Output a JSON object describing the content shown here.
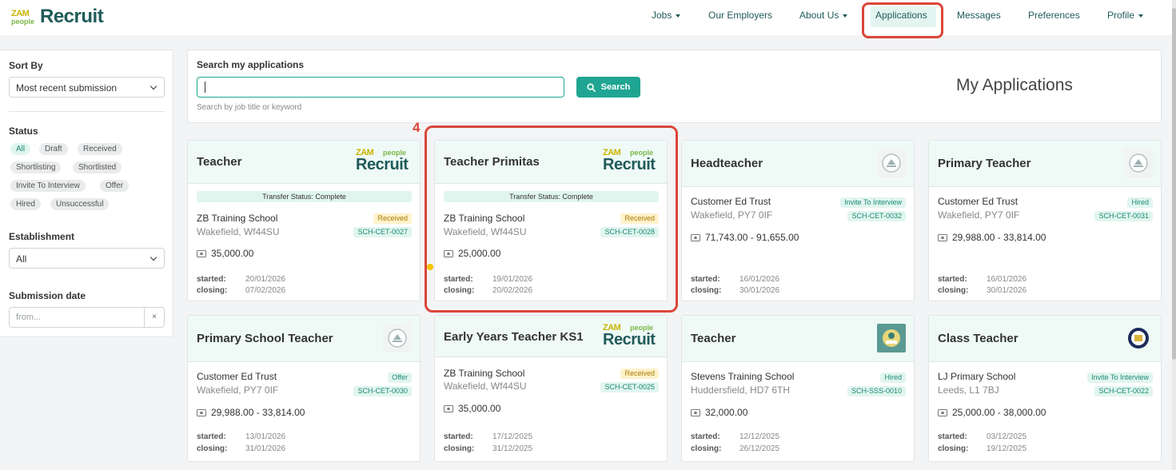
{
  "brand": {
    "logo_top": "ZAM",
    "logo_bottom": "people",
    "logo_word": "Recruit",
    "accent": "#20a592",
    "dark": "#1f5b59"
  },
  "nav": {
    "jobs": "Jobs",
    "employers": "Our Employers",
    "about": "About Us",
    "applications": "Applications",
    "messages": "Messages",
    "preferences": "Preferences",
    "profile": "Profile"
  },
  "sidebar": {
    "sort_label": "Sort By",
    "sort_value": "Most recent submission",
    "status_label": "Status",
    "statuses": [
      "All",
      "Draft",
      "Received",
      "Shortlisting",
      "Shortlisted",
      "Invite To Interview",
      "Offer",
      "Hired",
      "Unsuccessful"
    ],
    "establishment_label": "Establishment",
    "establishment_value": "All",
    "submission_label": "Submission date",
    "from_placeholder": "from...",
    "clear_symbol": "×"
  },
  "search": {
    "label": "Search my applications",
    "button": "Search",
    "help": "Search by job title or keyword",
    "value": ""
  },
  "page_title": "My Applications",
  "annotation": {
    "step": "4"
  },
  "cards": [
    {
      "title": "Teacher",
      "logo": "recruit",
      "transfer": "Transfer Status: Complete",
      "org": "ZB Training School",
      "location": "Wakefield, Wf44SU",
      "status": "Received",
      "ref": "SCH-CET-0027",
      "salary": "35,000.00",
      "started_label": "started:",
      "started": "20/01/2026",
      "closing_label": "closing:",
      "closing": "07/02/2026"
    },
    {
      "title": "Teacher Primitas",
      "logo": "recruit",
      "transfer": "Transfer Status: Complete",
      "org": "ZB Training School",
      "location": "Wakefield, Wf44SU",
      "status": "Received",
      "ref": "SCH-CET-0028",
      "salary": "25,000.00",
      "started_label": "started:",
      "started": "19/01/2026",
      "closing_label": "closing:",
      "closing": "20/02/2026"
    },
    {
      "title": "Headteacher",
      "logo": "crest-grey",
      "org": "Customer Ed Trust",
      "location": "Wakefield, PY7 0IF",
      "status": "Invite To Interview",
      "ref": "SCH-CET-0032",
      "salary": "71,743.00 - 91,655.00",
      "started_label": "started:",
      "started": "16/01/2026",
      "closing_label": "closing:",
      "closing": "30/01/2026"
    },
    {
      "title": "Primary Teacher",
      "logo": "crest-grey",
      "org": "Customer Ed Trust",
      "location": "Wakefield, PY7 0IF",
      "status": "Hired",
      "ref": "SCH-CET-0031",
      "salary": "29,988.00 - 33,814.00",
      "started_label": "started:",
      "started": "16/01/2026",
      "closing_label": "closing:",
      "closing": "30/01/2026"
    },
    {
      "title": "Primary School Teacher",
      "logo": "crest-grey",
      "org": "Customer Ed Trust",
      "location": "Wakefield, PY7 0IF",
      "status": "Offer",
      "ref": "SCH-CET-0030",
      "salary": "29,988.00 - 33,814.00",
      "started_label": "started:",
      "started": "13/01/2026",
      "closing_label": "closing:",
      "closing": "31/01/2026"
    },
    {
      "title": "Early Years Teacher KS1",
      "logo": "recruit",
      "org": "ZB Training School",
      "location": "Wakefield, Wf44SU",
      "status": "Received",
      "ref": "SCH-CET-0025",
      "salary": "35,000.00",
      "started_label": "started:",
      "started": "17/12/2025",
      "closing_label": "closing:",
      "closing": "31/12/2025"
    },
    {
      "title": "Teacher",
      "logo": "crest-green",
      "org": "Stevens Training School",
      "location": "Huddersfield, HD7 6TH",
      "status": "Hired",
      "ref": "SCH-SSS-0010",
      "salary": "32,000.00",
      "started_label": "started:",
      "started": "12/12/2025",
      "closing_label": "closing:",
      "closing": "26/12/2025"
    },
    {
      "title": "Class Teacher",
      "logo": "crest-navy",
      "org": "LJ Primary School",
      "location": "Leeds, L1 7BJ",
      "status": "Invite To Interview",
      "ref": "SCH-CET-0022",
      "salary": "25,000.00 - 38,000.00",
      "started_label": "started:",
      "started": "03/12/2025",
      "closing_label": "closing:",
      "closing": "19/12/2025"
    }
  ]
}
